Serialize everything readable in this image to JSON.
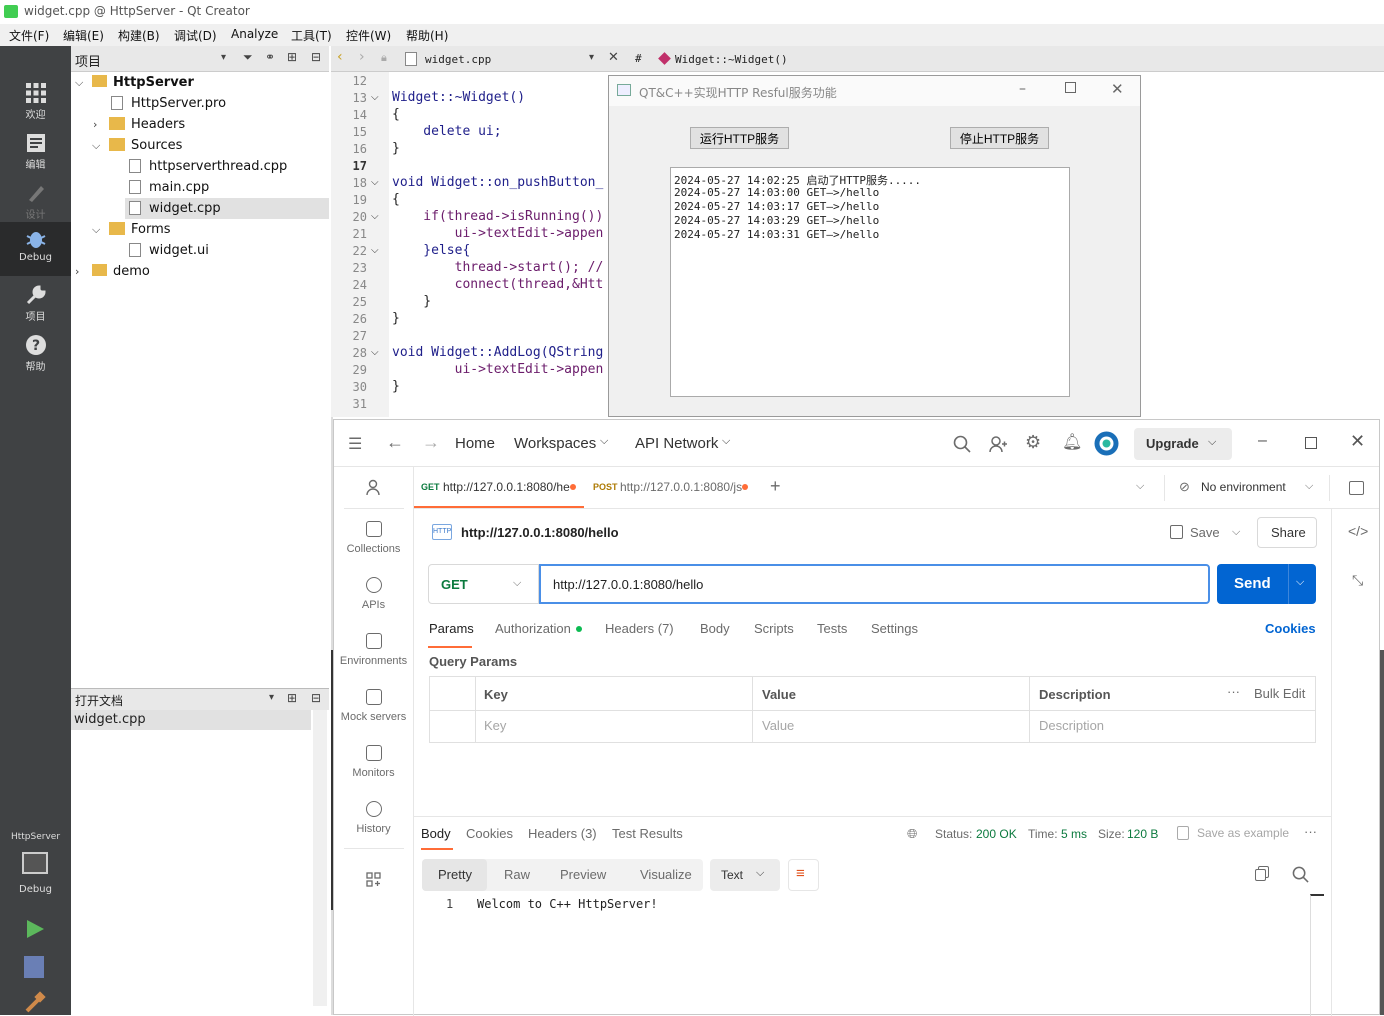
{
  "window_title": "widget.cpp @ HttpServer - Qt Creator",
  "menu": [
    "文件(F)",
    "编辑(E)",
    "构建(B)",
    "调试(D)",
    "Analyze",
    "工具(T)",
    "控件(W)",
    "帮助(H)"
  ],
  "modes": [
    "欢迎",
    "编辑",
    "设计",
    "Debug",
    "项目",
    "帮助"
  ],
  "kit": {
    "name": "HttpServer",
    "mode": "Debug"
  },
  "project_panel": {
    "title": "项目"
  },
  "editor": {
    "file": "widget.cpp",
    "symbol": "Widget::~Widget()",
    "hash": "#"
  },
  "tree": [
    {
      "label": "HttpServer",
      "bold": true
    },
    {
      "label": "HttpServer.pro"
    },
    {
      "label": "Headers"
    },
    {
      "label": "Sources"
    },
    {
      "label": "httpserverthread.cpp"
    },
    {
      "label": "main.cpp"
    },
    {
      "label": "widget.cpp"
    },
    {
      "label": "Forms"
    },
    {
      "label": "widget.ui"
    },
    {
      "label": "demo"
    }
  ],
  "open_docs": {
    "title": "打开文档",
    "items": [
      "widget.cpp"
    ]
  },
  "code_lines": [
    {
      "n": "12",
      "t": ""
    },
    {
      "n": "13",
      "t": "Widget::~Widget()"
    },
    {
      "n": "14",
      "t": "{"
    },
    {
      "n": "15",
      "t": "    delete ui;"
    },
    {
      "n": "16",
      "t": "}"
    },
    {
      "n": "17",
      "t": ""
    },
    {
      "n": "18",
      "t": "void Widget::on_pushButton_"
    },
    {
      "n": "19",
      "t": "{"
    },
    {
      "n": "20",
      "t": "    if(thread->isRunning())"
    },
    {
      "n": "21",
      "t": "        ui->textEdit->appen"
    },
    {
      "n": "22",
      "t": "    }else{"
    },
    {
      "n": "23",
      "t": "        thread->start(); //"
    },
    {
      "n": "24",
      "t": "        connect(thread,&Htt"
    },
    {
      "n": "25",
      "t": "    }"
    },
    {
      "n": "26",
      "t": "}"
    },
    {
      "n": "27",
      "t": ""
    },
    {
      "n": "28",
      "t": "void Widget::AddLog(QString"
    },
    {
      "n": "29",
      "t": "        ui->textEdit->appen"
    },
    {
      "n": "30",
      "t": "}"
    },
    {
      "n": "31",
      "t": ""
    }
  ],
  "dialog": {
    "title": "QT&C++实现HTTP Resful服务功能",
    "run_btn": "运行HTTP服务",
    "stop_btn": "停止HTTP服务",
    "log": [
      "2024-05-27 14:02:25 启动了HTTP服务.....",
      "2024-05-27 14:03:00 GET—>/hello",
      "2024-05-27 14:03:17 GET—>/hello",
      "2024-05-27 14:03:29 GET—>/hello",
      "2024-05-27 14:03:31 GET—>/hello"
    ]
  },
  "postman": {
    "nav": {
      "home": "Home",
      "workspaces": "Workspaces",
      "api_network": "API Network",
      "upgrade": "Upgrade"
    },
    "sidebar": [
      "Collections",
      "APIs",
      "Environments",
      "Mock servers",
      "Monitors",
      "History"
    ],
    "tabs": [
      {
        "method": "GET",
        "url": "http://127.0.0.1:8080/he"
      },
      {
        "method": "POST",
        "url": "http://127.0.0.1:8080/js"
      }
    ],
    "environment": "No environment",
    "request_title": "http://127.0.0.1:8080/hello",
    "save": "Save",
    "share": "Share",
    "method": "GET",
    "url": "http://127.0.0.1:8080/hello",
    "send": "Send",
    "req_tabs": [
      "Params",
      "Authorization",
      "Headers (7)",
      "Body",
      "Scripts",
      "Tests",
      "Settings"
    ],
    "cookies": "Cookies",
    "query_params": "Query Params",
    "table_headers": [
      "Key",
      "Value",
      "Description"
    ],
    "bulk_edit": "Bulk Edit",
    "placeholders": [
      "Key",
      "Value",
      "Description"
    ],
    "resp_tabs": [
      "Body",
      "Cookies",
      "Headers (3)",
      "Test Results"
    ],
    "status_label": "Status:",
    "status": "200 OK",
    "time_label": "Time:",
    "time": "5 ms",
    "size_label": "Size:",
    "size": "120 B",
    "save_example": "Save as example",
    "view_tabs": [
      "Pretty",
      "Raw",
      "Preview",
      "Visualize"
    ],
    "format": "Text",
    "response_line_no": "1",
    "response": "Welcom to C++ HttpServer!"
  }
}
